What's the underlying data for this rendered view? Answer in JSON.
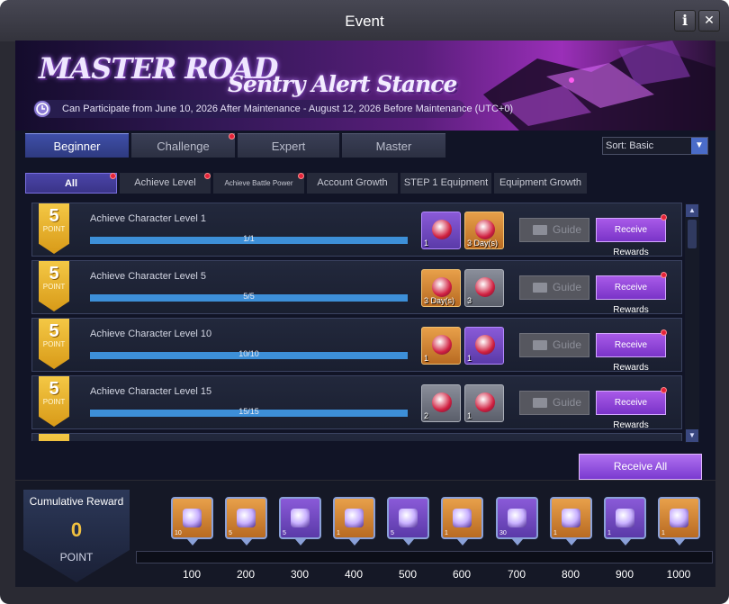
{
  "window": {
    "title": "Event",
    "info_label": "i",
    "close_label": "✕"
  },
  "banner": {
    "title": "MASTER ROAD",
    "subtitle": "Sentry Alert Stance",
    "period": "Can Participate from June 10, 2026 After Maintenance - August 12, 2026 Before Maintenance (UTC+0)"
  },
  "tabs": [
    {
      "label": "Beginner",
      "active": true,
      "notify": false
    },
    {
      "label": "Challenge",
      "active": false,
      "notify": true
    },
    {
      "label": "Expert",
      "active": false,
      "notify": false
    },
    {
      "label": "Master",
      "active": false,
      "notify": false
    }
  ],
  "sort": {
    "label": "Sort: Basic"
  },
  "subtabs": [
    {
      "label": "All",
      "active": true,
      "notify": true
    },
    {
      "label": "Achieve Level",
      "active": false,
      "notify": true
    },
    {
      "label": "Achieve Battle Power",
      "active": false,
      "notify": true
    },
    {
      "label": "Account Growth",
      "active": false,
      "notify": false
    },
    {
      "label": "STEP 1 Equipment",
      "active": false,
      "notify": false
    },
    {
      "label": "Equipment Growth",
      "active": false,
      "notify": false
    }
  ],
  "missions": [
    {
      "points": "5",
      "point_label": "POINT",
      "title": "Achieve Character Level 1",
      "progress_text": "1/1",
      "progress": 1.0,
      "rewards": [
        {
          "count": "1",
          "style": "purple"
        },
        {
          "count": "3 Day(s)",
          "style": "gold"
        }
      ],
      "guide_label": "Guide",
      "receive_label": "Receive Rewards"
    },
    {
      "points": "5",
      "point_label": "POINT",
      "title": "Achieve Character Level 5",
      "progress_text": "5/5",
      "progress": 1.0,
      "rewards": [
        {
          "count": "3 Day(s)",
          "style": "gold"
        },
        {
          "count": "3",
          "style": "gray"
        }
      ],
      "guide_label": "Guide",
      "receive_label": "Receive Rewards"
    },
    {
      "points": "5",
      "point_label": "POINT",
      "title": "Achieve Character Level 10",
      "progress_text": "10/10",
      "progress": 1.0,
      "rewards": [
        {
          "count": "1",
          "style": "gold"
        },
        {
          "count": "1",
          "style": "purple"
        }
      ],
      "guide_label": "Guide",
      "receive_label": "Receive Rewards"
    },
    {
      "points": "5",
      "point_label": "POINT",
      "title": "Achieve Character Level 15",
      "progress_text": "15/15",
      "progress": 1.0,
      "rewards": [
        {
          "count": "2",
          "style": "gray"
        },
        {
          "count": "1",
          "style": "gray"
        }
      ],
      "guide_label": "Guide",
      "receive_label": "Receive Rewards"
    }
  ],
  "receive_all_label": "Receive All",
  "cumulative": {
    "title": "Cumulative Reward",
    "value": "0",
    "unit": "POINT",
    "progress": 0
  },
  "milestones": [
    {
      "label": "100",
      "count": "10",
      "style": "gold"
    },
    {
      "label": "200",
      "count": "5",
      "style": "gold"
    },
    {
      "label": "300",
      "count": "5",
      "style": "purple"
    },
    {
      "label": "400",
      "count": "1",
      "style": "gold"
    },
    {
      "label": "500",
      "count": "5",
      "style": "purple"
    },
    {
      "label": "600",
      "count": "1",
      "style": "gold"
    },
    {
      "label": "700",
      "count": "30",
      "style": "purple"
    },
    {
      "label": "800",
      "count": "1",
      "style": "gold"
    },
    {
      "label": "900",
      "count": "1",
      "style": "purple"
    },
    {
      "label": "1000",
      "count": "1",
      "style": "gold"
    }
  ],
  "colors": {
    "accent": "#9a4ee0",
    "tab_active": "#3a46a0",
    "progress": "#3d8fd8",
    "badge": "#f0b830"
  }
}
